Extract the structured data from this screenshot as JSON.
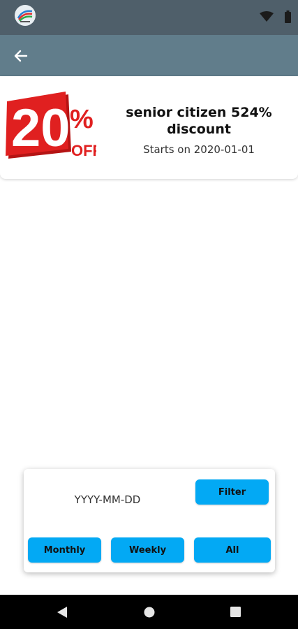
{
  "status_bar": {
    "logo_icon": "app-logo-icon",
    "wifi_icon": "wifi-icon",
    "battery_icon": "battery-icon",
    "background_color": "#4f5f6a"
  },
  "app_bar": {
    "back_icon": "arrow-back-icon",
    "background_color": "#617d8b"
  },
  "promo": {
    "badge": {
      "icon": "discount-badge-icon",
      "number": "20",
      "percent": "%",
      "off": "OFF",
      "color": "#e02020"
    },
    "title": "senior citizen 524% discount",
    "date_text": "Starts on 2020-01-01"
  },
  "filter": {
    "date_placeholder": "YYYY-MM-DD",
    "filter_label": "Filter",
    "monthly_label": "Monthly",
    "weekly_label": "Weekly",
    "all_label": "All",
    "accent_color": "#03a9f4"
  },
  "nav_bar": {
    "back_icon": "nav-back-icon",
    "home_icon": "nav-home-icon",
    "recents_icon": "nav-recents-icon"
  }
}
